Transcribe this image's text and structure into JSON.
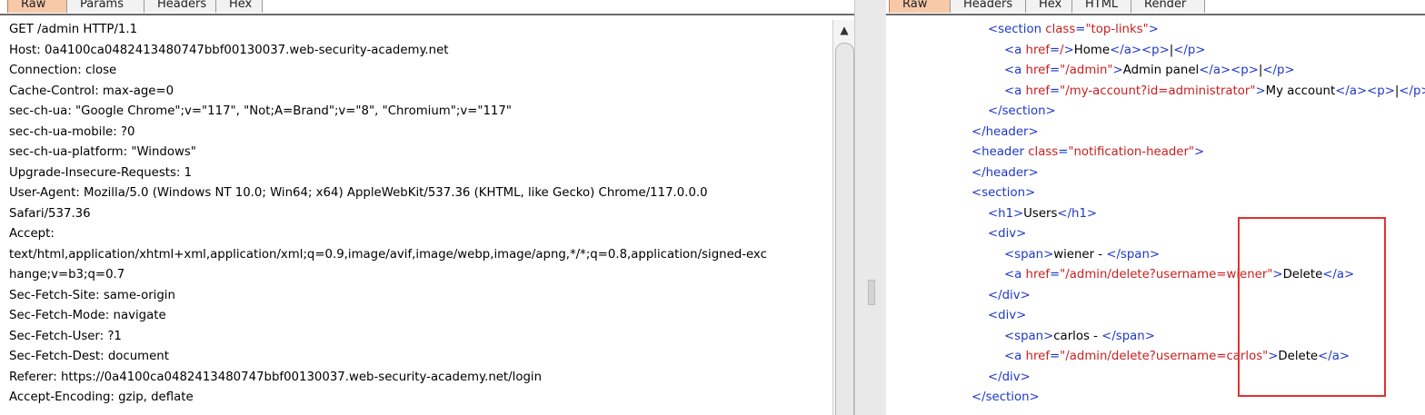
{
  "request_tabs": [
    "Raw",
    "Params",
    "Headers",
    "Hex"
  ],
  "response_tabs": [
    "Raw",
    "Headers",
    "Hex",
    "HTML",
    "Render"
  ],
  "request_lines": [
    "GET /admin HTTP/1.1",
    "Host: 0a4100ca0482413480747bbf00130037.web-security-academy.net",
    "Connection: close",
    "Cache-Control: max-age=0",
    "sec-ch-ua: \"Google Chrome\";v=\"117\", \"Not;A=Brand\";v=\"8\", \"Chromium\";v=\"117\"",
    "sec-ch-ua-mobile: ?0",
    "sec-ch-ua-platform: \"Windows\"",
    "Upgrade-Insecure-Requests: 1",
    "User-Agent: Mozilla/5.0 (Windows NT 10.0; Win64; x64) AppleWebKit/537.36 (KHTML, like Gecko) Chrome/117.0.0.0",
    "Safari/537.36",
    "Accept:",
    "text/html,application/xhtml+xml,application/xml;q=0.9,image/avif,image/webp,image/apng,*/*;q=0.8,application/signed-exc",
    "hange;v=b3;q=0.7",
    "Sec-Fetch-Site: same-origin",
    "Sec-Fetch-Mode: navigate",
    "Sec-Fetch-User: ?1",
    "Sec-Fetch-Dest: document",
    "Referer: https://0a4100ca0482413480747bbf00130037.web-security-academy.net/login",
    "Accept-Encoding: gzip, deflate"
  ],
  "response_lines": [
    {
      "indent": 112,
      "parts": [
        [
          "tag",
          "<section "
        ],
        [
          "attr",
          "class"
        ],
        [
          "tag",
          "="
        ],
        [
          "str",
          "\"top-links\""
        ],
        [
          "tag",
          ">"
        ]
      ]
    },
    {
      "indent": 130,
      "parts": [
        [
          "tag",
          "<a "
        ],
        [
          "attr",
          "href"
        ],
        [
          "tag",
          "="
        ],
        [
          "str",
          "/"
        ],
        [
          "tag",
          ">"
        ],
        [
          "txt",
          "Home"
        ],
        [
          "tag",
          "</a><p>"
        ],
        [
          "txt",
          "|"
        ],
        [
          "tag",
          "</p>"
        ]
      ]
    },
    {
      "indent": 130,
      "parts": [
        [
          "tag",
          "<a "
        ],
        [
          "attr",
          "href"
        ],
        [
          "tag",
          "="
        ],
        [
          "str",
          "\"/admin\""
        ],
        [
          "tag",
          ">"
        ],
        [
          "txt",
          "Admin panel"
        ],
        [
          "tag",
          "</a><p>"
        ],
        [
          "txt",
          "|"
        ],
        [
          "tag",
          "</p>"
        ]
      ]
    },
    {
      "indent": 130,
      "parts": [
        [
          "tag",
          "<a "
        ],
        [
          "attr",
          "href"
        ],
        [
          "tag",
          "="
        ],
        [
          "str",
          "\"/my-account?id=administrator\""
        ],
        [
          "tag",
          ">"
        ],
        [
          "txt",
          "My account"
        ],
        [
          "tag",
          "</a><p>"
        ],
        [
          "txt",
          "|"
        ],
        [
          "tag",
          "</p>"
        ]
      ]
    },
    {
      "indent": 112,
      "parts": [
        [
          "tag",
          "</section>"
        ]
      ]
    },
    {
      "indent": 94,
      "parts": [
        [
          "tag",
          "</header>"
        ]
      ]
    },
    {
      "indent": 94,
      "parts": [
        [
          "tag",
          "<header "
        ],
        [
          "attr",
          "class"
        ],
        [
          "tag",
          "="
        ],
        [
          "str",
          "\"notification-header\""
        ],
        [
          "tag",
          ">"
        ]
      ]
    },
    {
      "indent": 94,
      "parts": [
        [
          "tag",
          "</header>"
        ]
      ]
    },
    {
      "indent": 94,
      "parts": [
        [
          "tag",
          "<section>"
        ]
      ]
    },
    {
      "indent": 112,
      "parts": [
        [
          "tag",
          "<h1>"
        ],
        [
          "txt",
          "Users"
        ],
        [
          "tag",
          "</h1>"
        ]
      ]
    },
    {
      "indent": 112,
      "parts": [
        [
          "tag",
          "<div>"
        ]
      ]
    },
    {
      "indent": 130,
      "parts": [
        [
          "tag",
          "<span>"
        ],
        [
          "txt",
          "wiener - "
        ],
        [
          "tag",
          "</span>"
        ]
      ]
    },
    {
      "indent": 130,
      "parts": [
        [
          "tag",
          "<a "
        ],
        [
          "attr",
          "href"
        ],
        [
          "tag",
          "="
        ],
        [
          "str",
          "\"/admin/delete?username=wiener\""
        ],
        [
          "tag",
          ">"
        ],
        [
          "txt",
          "Delete"
        ],
        [
          "tag",
          "</a>"
        ]
      ]
    },
    {
      "indent": 112,
      "parts": [
        [
          "tag",
          "</div>"
        ]
      ]
    },
    {
      "indent": 112,
      "parts": [
        [
          "tag",
          "<div>"
        ]
      ]
    },
    {
      "indent": 130,
      "parts": [
        [
          "tag",
          "<span>"
        ],
        [
          "txt",
          "carlos - "
        ],
        [
          "tag",
          "</span>"
        ]
      ]
    },
    {
      "indent": 130,
      "parts": [
        [
          "tag",
          "<a "
        ],
        [
          "attr",
          "href"
        ],
        [
          "tag",
          "="
        ],
        [
          "str",
          "\"/admin/delete?username=carlos\""
        ],
        [
          "tag",
          ">"
        ],
        [
          "txt",
          "Delete"
        ],
        [
          "tag",
          "</a>"
        ]
      ]
    },
    {
      "indent": 112,
      "parts": [
        [
          "tag",
          "</div>"
        ]
      ]
    },
    {
      "indent": 94,
      "parts": [
        [
          "tag",
          "</section>"
        ]
      ]
    }
  ],
  "colors": {
    "active_tab": "#f7c9a8",
    "tag": "#1f38c8",
    "attr": "#c81f1f",
    "highlight": "#e53030"
  },
  "icons": {
    "scroll_up": "▲"
  }
}
